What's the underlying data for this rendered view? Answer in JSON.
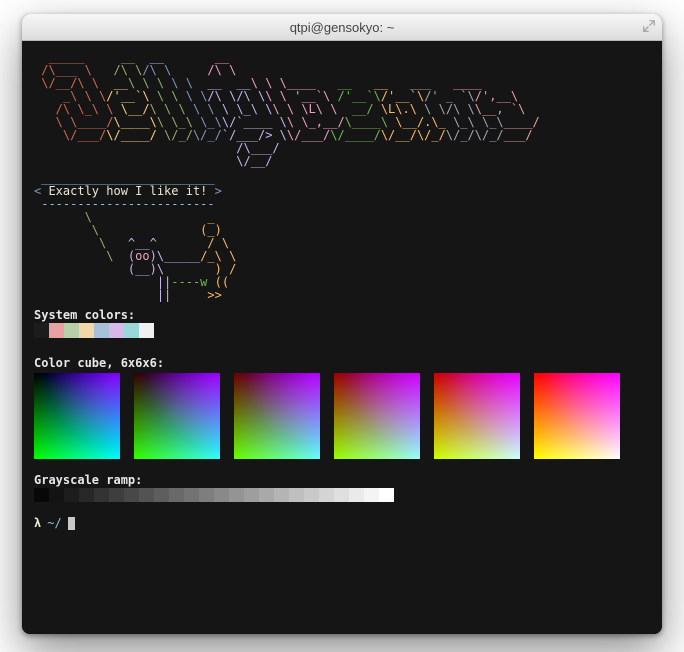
{
  "window": {
    "title": "qtpi@gensokyo: ~"
  },
  "labels": {
    "system_colors": "System colors:",
    "color_cube": "Color cube, 6x6x6:",
    "grayscale": "Grayscale ramp:"
  },
  "speech_bubble": "Exactly how I like it!",
  "prompt": {
    "symbol": "λ",
    "path": "~/"
  },
  "system_colors": [
    "#1c1c1c",
    "#e8a0a0",
    "#b8d0a8",
    "#f0d8a8",
    "#a8c0d8",
    "#d8b8e8",
    "#98d8d8",
    "#f0f0f0"
  ],
  "cube_base_tints": [
    "0,0,0",
    "51,0,0",
    "102,0,0",
    "153,0,0",
    "204,0,0",
    "255,0,0"
  ],
  "grayscale_steps": 24
}
